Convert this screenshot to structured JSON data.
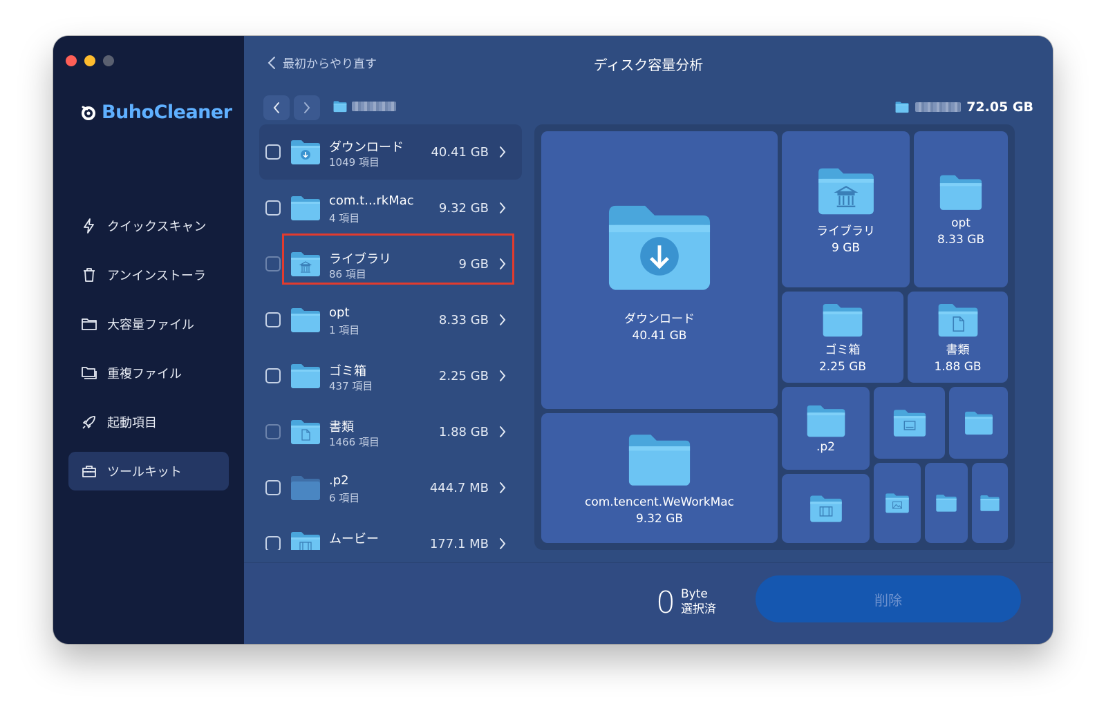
{
  "app": {
    "name": "BuhoCleaner"
  },
  "sidebar": {
    "items": [
      {
        "label": "クイックスキャン",
        "icon": "lightning-icon"
      },
      {
        "label": "アンインストーラ",
        "icon": "trash-icon"
      },
      {
        "label": "大容量ファイル",
        "icon": "folder-icon"
      },
      {
        "label": "重複ファイル",
        "icon": "duplicate-folder-icon"
      },
      {
        "label": "起動項目",
        "icon": "rocket-icon"
      },
      {
        "label": "ツールキット",
        "icon": "toolbox-icon",
        "active": true
      }
    ]
  },
  "header": {
    "back_label": "最初からやり直す",
    "title": "ディスク容量分析",
    "total_size": "72.05 GB"
  },
  "list": {
    "items": [
      {
        "name": "ダウンロード",
        "count": "1049 項目",
        "size": "40.41 GB",
        "icon": "download-folder-icon",
        "selected": true
      },
      {
        "name": "com.t...rkMac",
        "count": "4 項目",
        "size": "9.32 GB",
        "icon": "folder-icon"
      },
      {
        "name": "ライブラリ",
        "count": "86 項目",
        "size": "9 GB",
        "icon": "library-folder-icon",
        "highlighted": true
      },
      {
        "name": "opt",
        "count": "1 項目",
        "size": "8.33 GB",
        "icon": "folder-icon"
      },
      {
        "name": "ゴミ箱",
        "count": "437 項目",
        "size": "2.25 GB",
        "icon": "folder-icon"
      },
      {
        "name": "書類",
        "count": "1466 項目",
        "size": "1.88 GB",
        "icon": "document-folder-icon"
      },
      {
        "name": ".p2",
        "count": "6 項目",
        "size": "444.7 MB",
        "icon": "folder-icon"
      },
      {
        "name": "ムービー",
        "count": "",
        "size": "177.1 MB",
        "icon": "movie-folder-icon"
      }
    ]
  },
  "treemap": {
    "tiles": [
      {
        "name": "ダウンロード",
        "size": "40.41 GB",
        "icon": "download-folder-icon"
      },
      {
        "name": "ライブラリ",
        "size": "9 GB",
        "icon": "library-folder-icon"
      },
      {
        "name": "opt",
        "size": "8.33 GB",
        "icon": "folder-icon"
      },
      {
        "name": "ゴミ箱",
        "size": "2.25 GB",
        "icon": "folder-icon"
      },
      {
        "name": "書類",
        "size": "1.88 GB",
        "icon": "document-folder-icon"
      },
      {
        "name": "com.tencent.WeWorkMac",
        "size": "9.32 GB",
        "icon": "folder-icon"
      },
      {
        "name": ".p2",
        "size": "",
        "icon": "folder-icon"
      }
    ]
  },
  "footer": {
    "selected_count": "0",
    "selected_unit": "Byte",
    "selected_label": "選択済",
    "delete_label": "削除"
  },
  "colors": {
    "sidebar_bg": "#121d3c",
    "main_bg": "#2f4c80",
    "brand": "#5fb0ff",
    "folder": "#6cc4f3",
    "tile": "#3c5ea6",
    "delete_button": "#1557b0",
    "highlight_border": "#e23b2e"
  }
}
